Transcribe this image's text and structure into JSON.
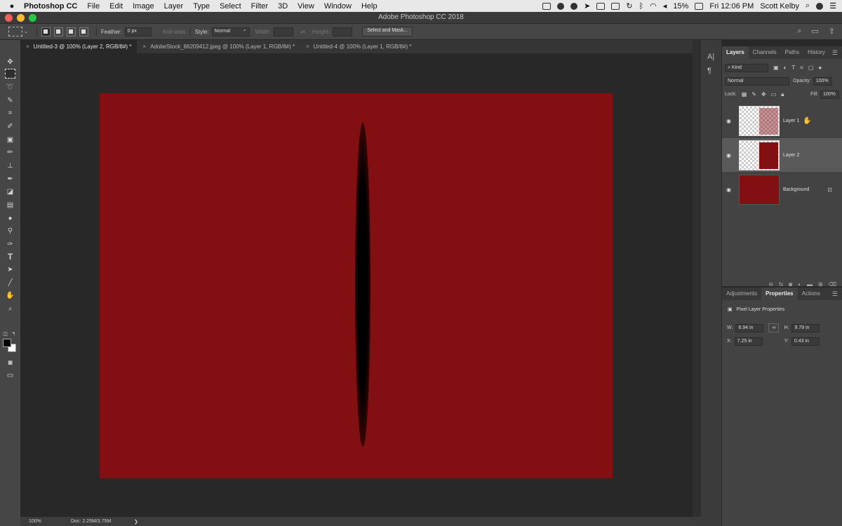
{
  "menubar": {
    "apple": "",
    "app_name": "Photoshop CC",
    "menus": [
      "File",
      "Edit",
      "Image",
      "Layer",
      "Type",
      "Select",
      "Filter",
      "3D",
      "View",
      "Window",
      "Help"
    ],
    "battery": "15%",
    "clock": "Fri 12:06 PM",
    "user": "Scott Kelby"
  },
  "window": {
    "title": "Adobe Photoshop CC 2018",
    "traffic_colors": [
      "#fc5f57",
      "#fdbc2e",
      "#28c840"
    ]
  },
  "options_bar": {
    "feather_label": "Feather:",
    "feather_value": "0 px",
    "anti_alias": "Anti-alias",
    "style_label": "Style:",
    "style_value": "Normal",
    "width_label": "Width:",
    "height_label": "Height:",
    "select_mask": "Select and Mask..."
  },
  "tabs": [
    {
      "label": "Untitled-3 @ 100% (Layer 2, RGB/8#) *",
      "active": true
    },
    {
      "label": "AdobeStock_86209412.jpeg @ 100% (Layer 1, RGB/8#) *",
      "active": false
    },
    {
      "label": "Untitled-4 @ 100% (Layer 1, RGB/8#) *",
      "active": false
    }
  ],
  "canvas": {
    "color": "#820f12"
  },
  "statusbar": {
    "zoom": "100%",
    "doc": "Doc: 2.25M/3.75M",
    "arrow": "❯"
  },
  "layers_panel": {
    "tabs": [
      "Layers",
      "Channels",
      "Paths",
      "History"
    ],
    "kind_label": "Kind",
    "blend_mode": "Normal",
    "opacity_label": "Opacity:",
    "opacity_value": "100%",
    "lock_label": "Lock:",
    "fill_label": "Fill:",
    "fill_value": "100%",
    "layers": [
      {
        "name": "Layer 1",
        "selected": false
      },
      {
        "name": "Layer 2",
        "selected": true
      },
      {
        "name": "Background",
        "selected": false
      }
    ]
  },
  "properties_panel": {
    "tabs": [
      "Adjustments",
      "Properties",
      "Actions"
    ],
    "header": "Pixel Layer Properties",
    "w_label": "W:",
    "w_value": "6.94 in",
    "h_label": "H:",
    "h_value": "9.79 in",
    "x_label": "X:",
    "x_value": "7.25 in",
    "y_label": "Y:",
    "y_value": "0.43 in"
  }
}
